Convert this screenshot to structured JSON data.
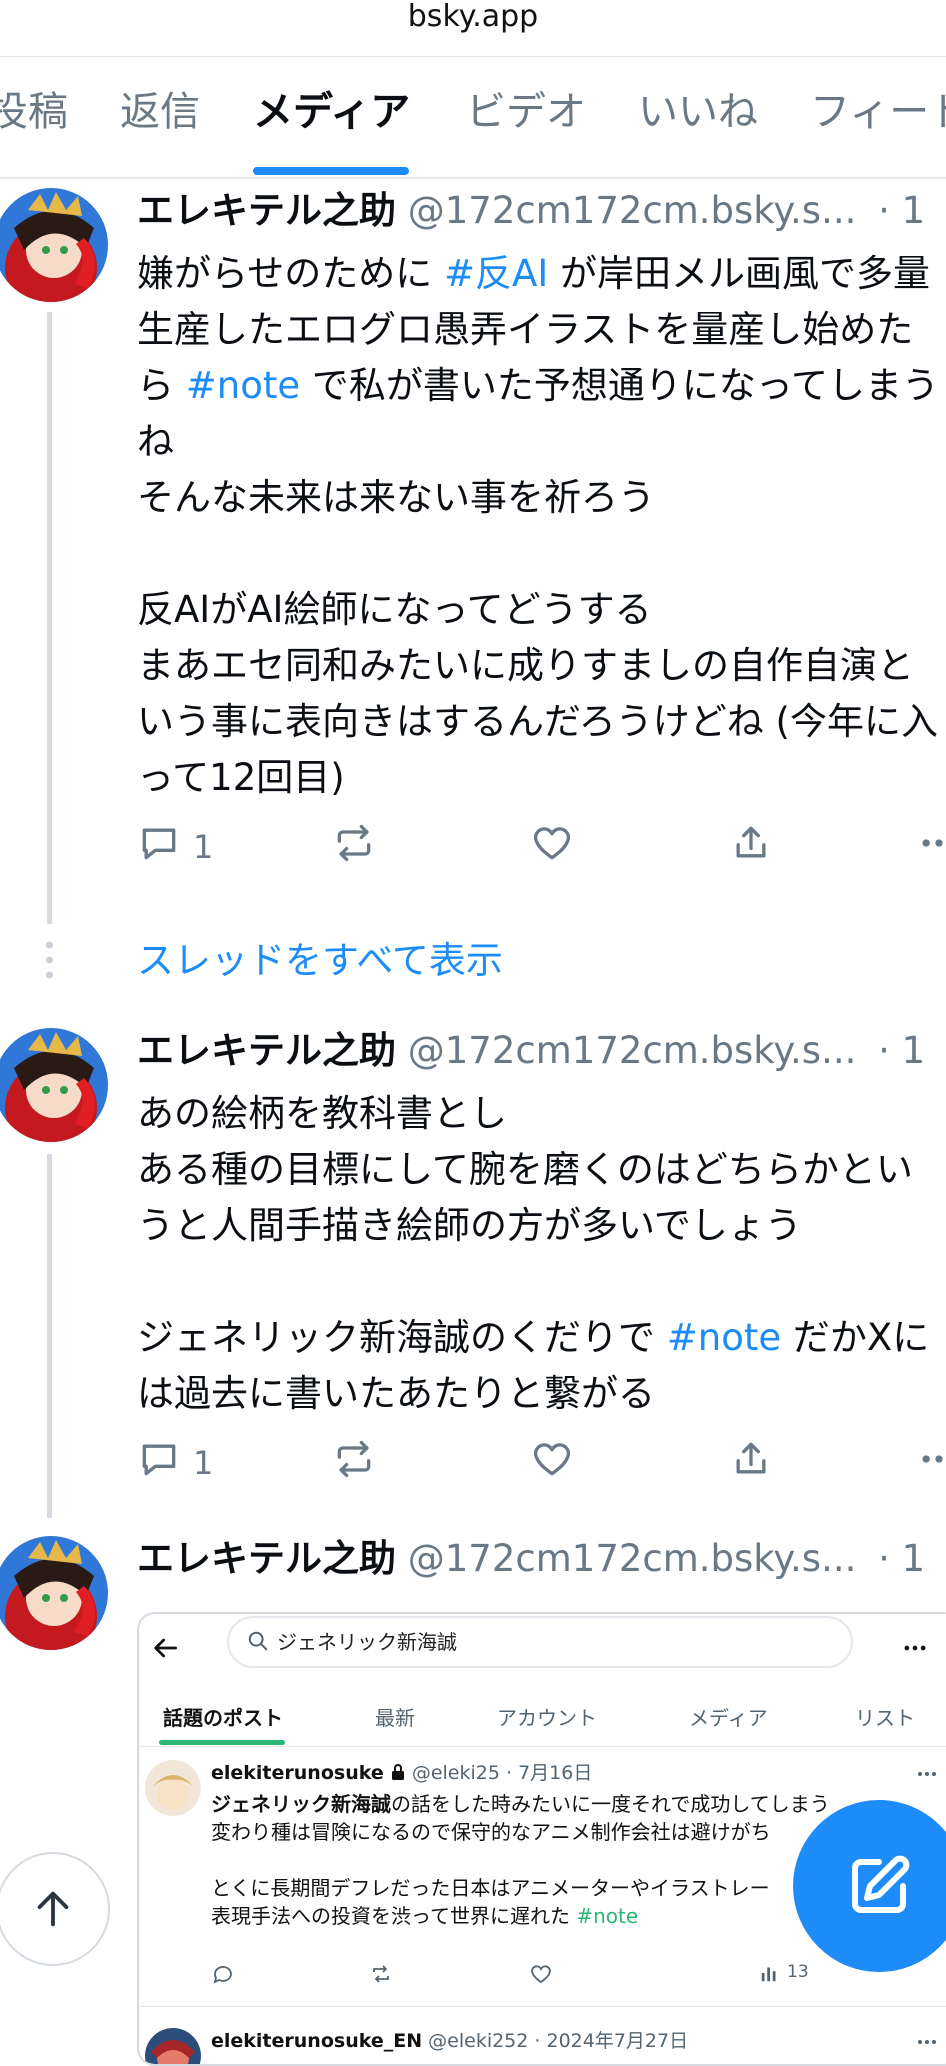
{
  "browser": {
    "url": "bsky.app"
  },
  "tabs": [
    {
      "label": "投稿"
    },
    {
      "label": "返信"
    },
    {
      "label": "メディア"
    },
    {
      "label": "ビデオ"
    },
    {
      "label": "いいね"
    },
    {
      "label": "フィード"
    }
  ],
  "active_tab": "メディア",
  "posts": [
    {
      "author": "エレキテル之助",
      "handle": "@172cm172cm.bsky.s...",
      "time": "· 1",
      "body": [
        {
          "t": "嫌がらせのために "
        },
        {
          "t": "#反AI",
          "tag": true
        },
        {
          "t": " が岸田メル画風で多量\n生産したエログロ愚弄イラストを量産し始めた\nら "
        },
        {
          "t": "#note",
          "tag": true
        },
        {
          "t": " で私が書いた予想通りになってしまう\nね\nそんな未来は来ない事を祈ろう\n\n反AIがAI絵師になってどうする\nまあエセ同和みたいに成りすましの自作自演と\nいう事に表向きはするんだろうけどね (今年に入\nって12回目)"
        }
      ],
      "reply_count": "1"
    },
    {
      "author": "エレキテル之助",
      "handle": "@172cm172cm.bsky.s...",
      "time": "· 1",
      "body": [
        {
          "t": "あの絵柄を教科書とし\nある種の目標にして腕を磨くのはどちらかとい\nうと人間手描き絵師の方が多いでしょう\n\nジェネリック新海誠のくだりで "
        },
        {
          "t": "#note",
          "tag": true
        },
        {
          "t": " だかXに\nは過去に書いたあたりと繋がる"
        }
      ],
      "reply_count": "1"
    },
    {
      "author": "エレキテル之助",
      "handle": "@172cm172cm.bsky.s...",
      "time": "· 1"
    }
  ],
  "show_thread": "スレッドをすべて表示",
  "embed": {
    "search_value": "ジェネリック新海誠",
    "tabs": [
      "話題のポスト",
      "最新",
      "アカウント",
      "メディア",
      "リスト"
    ],
    "post1": {
      "name": "elekiterunosuke",
      "handle": "@eleki25 · 7月16日",
      "line1_bold": "ジェネリック新海誠",
      "line1": "の話をした時みたいに一度それで成功してしまう",
      "line2": "変わり種は冒険になるので保守的なアニメ制作会社は避けがち",
      "line3": "とくに長期間デフレだった日本はアニメーターやイラストレー",
      "line4": "表現手法への投資を渋って世界に遅れた ",
      "line4_tag": "#note",
      "views": "13"
    },
    "post2": {
      "name": "elekiterunosuke_EN",
      "handle": "@eleki252 · 2024年7月27日"
    }
  },
  "colors": {
    "accent": "#1d8cf8",
    "muted": "#6a7886",
    "divider": "#d5dbe1"
  }
}
